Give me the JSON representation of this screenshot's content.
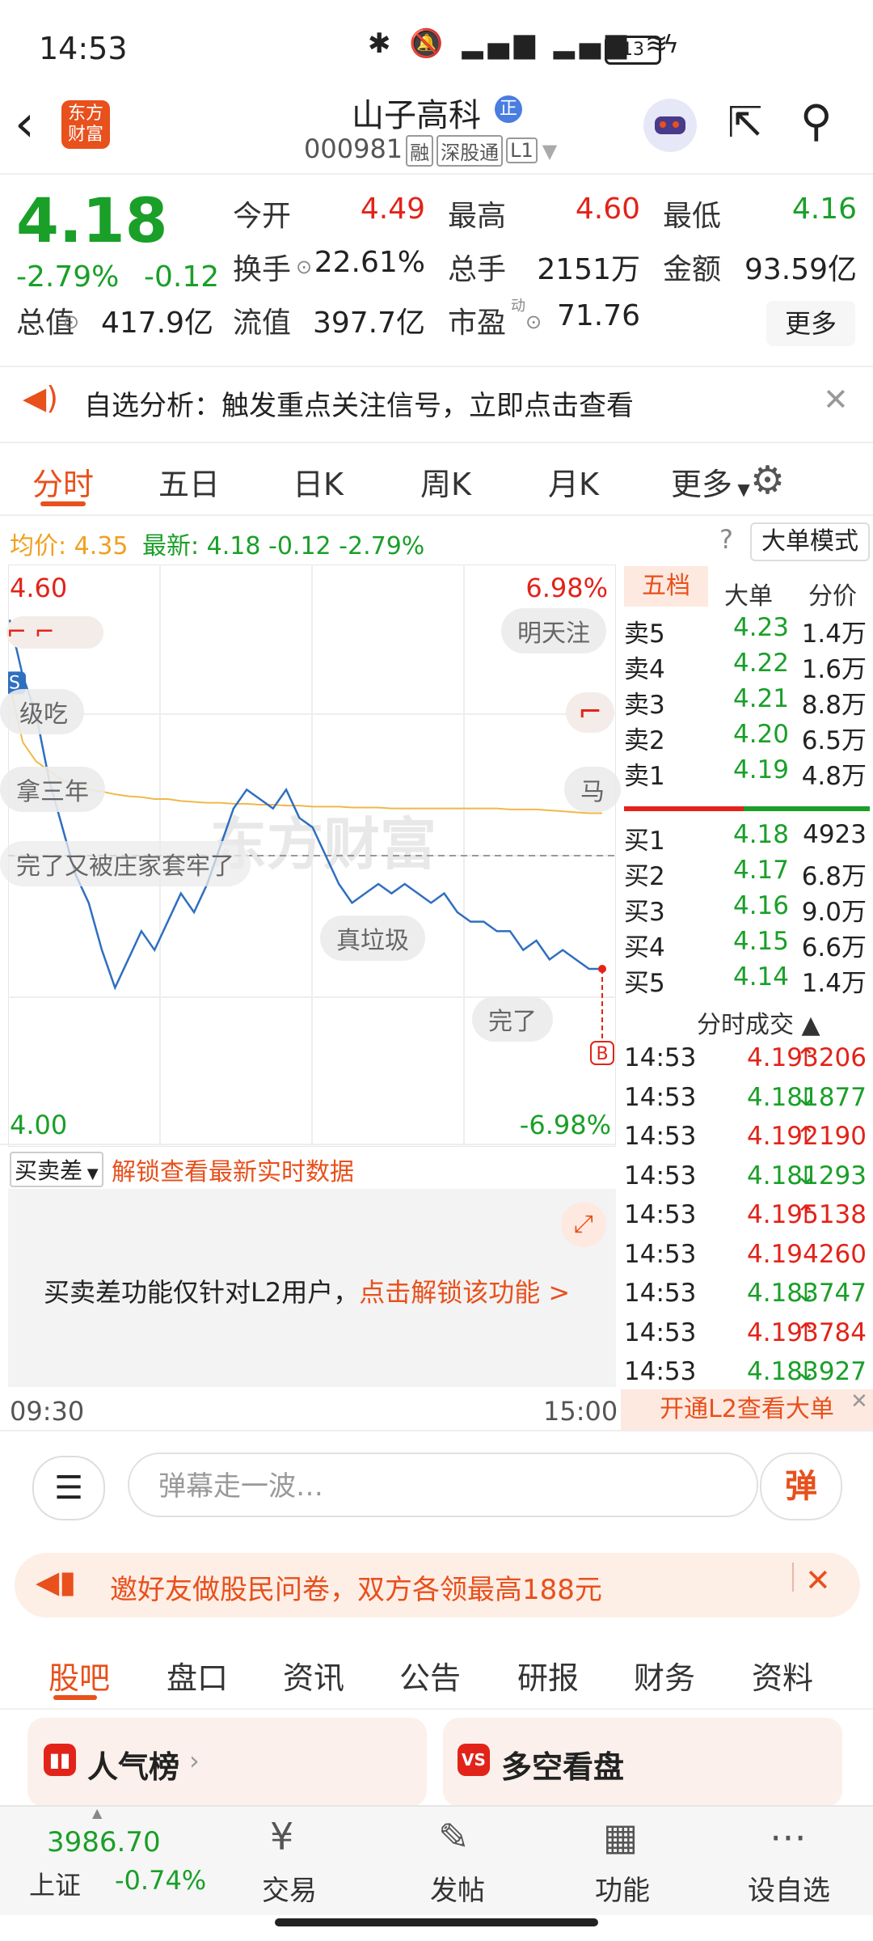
{
  "status_bar": {
    "time": "14:53",
    "battery": "13"
  },
  "header": {
    "logo_line1": "东方",
    "logo_line2": "财富",
    "stock_name": "山子高科",
    "badge": "正",
    "code": "000981",
    "tags": [
      "融",
      "深股通",
      "L1"
    ]
  },
  "quote": {
    "price": "4.18",
    "change_pct": "-2.79%",
    "change": "-0.12",
    "fields": [
      {
        "label": "今开",
        "value": "4.49",
        "color": "#e2231a"
      },
      {
        "label": "最高",
        "value": "4.60",
        "color": "#e2231a"
      },
      {
        "label": "最低",
        "value": "4.16",
        "color": "#1a9f29"
      },
      {
        "label": "换手",
        "value": "22.61%",
        "color": "#222222"
      },
      {
        "label": "总手",
        "value": "2151万",
        "color": "#222222"
      },
      {
        "label": "金额",
        "value": "93.59亿",
        "color": "#222222"
      },
      {
        "label": "总值",
        "value": "417.9亿",
        "color": "#222222"
      },
      {
        "label": "流值",
        "value": "397.7亿",
        "color": "#222222"
      },
      {
        "label": "市盈",
        "value": "71.76",
        "color": "#222222"
      }
    ],
    "pe_sup": "动",
    "more": "更多"
  },
  "banner": {
    "text": "自选分析：触发重点关注信号，立即点击查看"
  },
  "chart_tabs": [
    "分时",
    "五日",
    "日K",
    "周K",
    "月K",
    "更多"
  ],
  "chart_info": {
    "avg_label": "均价:",
    "avg_value": "4.35",
    "latest_label": "最新:",
    "latest_value": "4.18",
    "latest_change": "-0.12",
    "latest_pct": "-2.79%",
    "big_order_btn": "大单模式"
  },
  "chart_labels": {
    "y_top": "4.60",
    "y_top_pct": "6.98%",
    "y_bottom": "4.00",
    "y_bottom_pct": "-6.98%",
    "bubbles": [
      "明天注",
      "级吃",
      "拿三年",
      "马",
      "完了又被庄家套牢了",
      "真垃圾",
      "完了"
    ],
    "marker_s": "S",
    "marker_b": "B",
    "watermark": "东方财富"
  },
  "chart_data": {
    "type": "line",
    "title": "",
    "xlabel": "",
    "ylabel": "",
    "x_range": [
      "09:30",
      "15:00"
    ],
    "ylim": [
      4.0,
      4.6
    ],
    "prev_close": 4.3,
    "series": [
      {
        "name": "",
        "values": [
          4.55,
          4.49,
          4.45,
          4.38,
          4.33,
          4.28,
          4.25,
          4.2,
          4.16,
          4.19,
          4.22,
          4.2,
          4.23,
          4.26,
          4.24,
          4.27,
          4.31,
          4.35,
          4.37,
          4.36,
          4.35,
          4.37,
          4.34,
          4.33,
          4.3,
          4.27,
          4.25,
          4.26,
          4.27,
          4.26,
          4.27,
          4.26,
          4.25,
          4.26,
          4.24,
          4.23,
          4.23,
          4.22,
          4.22,
          4.2,
          4.21,
          4.19,
          4.2,
          4.19,
          4.18,
          4.18
        ]
      },
      {
        "name": "",
        "values": [
          4.48,
          4.42,
          4.4,
          4.39,
          4.38,
          4.375,
          4.37,
          4.368,
          4.365,
          4.363,
          4.362,
          4.36,
          4.36,
          4.358,
          4.357,
          4.356,
          4.356,
          4.355,
          4.355,
          4.354,
          4.354,
          4.353,
          4.353,
          4.352,
          4.352,
          4.352,
          4.351,
          4.351,
          4.351,
          4.35,
          4.35,
          4.35,
          4.35,
          4.35,
          4.35,
          4.35,
          4.35,
          4.35,
          4.349,
          4.349,
          4.349,
          4.348,
          4.347,
          4.346,
          4.345,
          4.345
        ]
      }
    ]
  },
  "order_book": {
    "tabs": [
      "五档",
      "大单",
      "分价"
    ],
    "asks": [
      {
        "label": "卖5",
        "price": "4.23",
        "vol": "1.4万"
      },
      {
        "label": "卖4",
        "price": "4.22",
        "vol": "1.6万"
      },
      {
        "label": "卖3",
        "price": "4.21",
        "vol": "8.8万"
      },
      {
        "label": "卖2",
        "price": "4.20",
        "vol": "6.5万"
      },
      {
        "label": "卖1",
        "price": "4.19",
        "vol": "4.8万"
      }
    ],
    "bids": [
      {
        "label": "买1",
        "price": "4.18",
        "vol": "4923"
      },
      {
        "label": "买2",
        "price": "4.17",
        "vol": "6.8万"
      },
      {
        "label": "买3",
        "price": "4.16",
        "vol": "9.0万"
      },
      {
        "label": "买4",
        "price": "4.15",
        "vol": "6.6万"
      },
      {
        "label": "买5",
        "price": "4.14",
        "vol": "1.4万"
      }
    ],
    "trades_title": "分时成交",
    "trades": [
      {
        "time": "14:53",
        "price": "4.19",
        "arrow": "↑",
        "vol": "3206",
        "color": "#e2231a"
      },
      {
        "time": "14:53",
        "price": "4.18",
        "arrow": "↓",
        "vol": "1877",
        "color": "#1a9f29"
      },
      {
        "time": "14:53",
        "price": "4.19",
        "arrow": "↑",
        "vol": "2190",
        "color": "#e2231a"
      },
      {
        "time": "14:53",
        "price": "4.18",
        "arrow": "↓",
        "vol": "1293",
        "color": "#1a9f29"
      },
      {
        "time": "14:53",
        "price": "4.19",
        "arrow": "↑",
        "vol": "5138",
        "color": "#e2231a"
      },
      {
        "time": "14:53",
        "price": "4.19",
        "arrow": " ",
        "vol": "4260",
        "color": "#e2231a"
      },
      {
        "time": "14:53",
        "price": "4.18",
        "arrow": "↓",
        "vol": "3747",
        "color": "#1a9f29"
      },
      {
        "time": "14:53",
        "price": "4.19",
        "arrow": "↑",
        "vol": "3784",
        "color": "#e2231a"
      },
      {
        "time": "14:53",
        "price": "4.18",
        "arrow": "↓",
        "vol": "3927",
        "color": "#1a9f29"
      }
    ],
    "l2_btn": "开通L2查看大单"
  },
  "lower_panel": {
    "label": "买卖差",
    "unlock_text": "解锁查看最新实时数据",
    "l2_text": "买卖差功能仅针对L2用户，",
    "l2_link": "点击解锁该功能 >",
    "time_start": "09:30",
    "time_end": "15:00"
  },
  "comment": {
    "placeholder": "弹幕走一波…",
    "dan": "弹"
  },
  "invite": {
    "text": "邀好友做股民问卷，双方各领最高188元"
  },
  "bottom_tabs": [
    "股吧",
    "盘口",
    "资讯",
    "公告",
    "研报",
    "财务",
    "资料"
  ],
  "cards": [
    {
      "title": "人气榜"
    },
    {
      "title": "多空看盘"
    }
  ],
  "bottom_nav": {
    "index_value": "3986.70",
    "index_name": "上证",
    "index_change": "-0.74%",
    "items": [
      {
        "label": "交易",
        "icon": "trade-icon"
      },
      {
        "label": "发帖",
        "icon": "post-icon"
      },
      {
        "label": "功能",
        "icon": "grid-icon"
      },
      {
        "label": "设自选",
        "icon": "more-icon"
      }
    ]
  },
  "colors": {
    "up": "#e2231a",
    "down": "#1a9f29",
    "accent": "#e8501c",
    "avg_line": "#f0b84a",
    "price_line": "#2f6fc0"
  }
}
